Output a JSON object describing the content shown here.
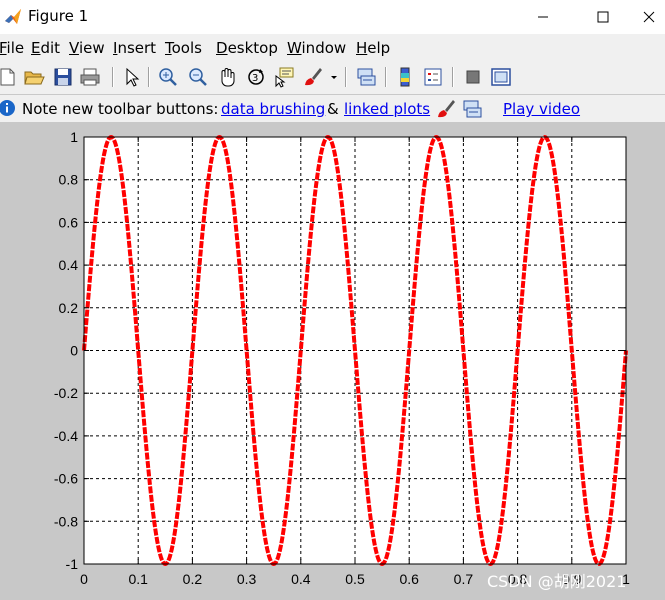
{
  "window": {
    "title": "Figure 1",
    "minimize": "—",
    "maximize": "☐",
    "close": "✕"
  },
  "menu": [
    {
      "label": "File",
      "u": "F",
      "rest": "ile"
    },
    {
      "label": "Edit",
      "u": "E",
      "rest": "dit"
    },
    {
      "label": "View",
      "u": "V",
      "rest": "iew"
    },
    {
      "label": "Insert",
      "u": "I",
      "rest": "nsert"
    },
    {
      "label": "Tools",
      "u": "T",
      "rest": "ools"
    },
    {
      "label": "Desktop",
      "u": "D",
      "rest": "esktop"
    },
    {
      "label": "Window",
      "u": "W",
      "rest": "indow"
    },
    {
      "label": "Help",
      "u": "H",
      "rest": "elp"
    }
  ],
  "toolbar_icons": [
    "new-figure-icon",
    "open-file-icon",
    "save-icon",
    "print-icon",
    "edit-plot-icon",
    "zoom-in-icon",
    "zoom-out-icon",
    "pan-icon",
    "rotate-3d-icon",
    "data-cursor-icon",
    "brush-icon",
    "brush-dropdown-icon",
    "link-plot-icon",
    "insert-colorbar-icon",
    "insert-legend-icon",
    "hide-plot-tools-icon",
    "show-plot-tools-icon"
  ],
  "infobar": {
    "note": "Note new toolbar buttons:",
    "link1": "data brushing",
    "amp": "&",
    "link2": "linked plots",
    "video": "Play video"
  },
  "chart_data": {
    "type": "line",
    "title": "",
    "xlabel": "",
    "ylabel": "",
    "xlim": [
      0,
      1
    ],
    "ylim": [
      -1,
      1
    ],
    "grid": true,
    "x_ticks": [
      "0",
      "0.1",
      "0.2",
      "0.3",
      "0.4",
      "0.5",
      "0.6",
      "0.7",
      "0.8",
      "0.9",
      "1"
    ],
    "y_ticks": [
      "1",
      "0.8",
      "0.6",
      "0.4",
      "0.2",
      "0",
      "-0.2",
      "-0.4",
      "-0.6",
      "-0.8",
      "-1"
    ],
    "series": [
      {
        "function": "sin(2*pi*5*x)",
        "color": "#ff0000",
        "x": [
          0,
          0.025,
          0.05,
          0.075,
          0.1,
          0.125,
          0.15,
          0.175,
          0.2,
          0.25,
          0.3,
          0.35,
          0.4,
          0.45,
          0.5,
          0.55,
          0.6,
          0.65,
          0.7,
          0.75,
          0.8,
          0.85,
          0.9,
          0.95,
          1
        ],
        "y": [
          0,
          0.707,
          1,
          0.707,
          0,
          -0.707,
          -1,
          -0.707,
          0,
          1,
          0,
          -1,
          0,
          1,
          0,
          -1,
          0,
          1,
          0,
          -1,
          0,
          1,
          0,
          -1,
          0
        ]
      }
    ]
  },
  "watermark": "CSDN @胡刚2021"
}
